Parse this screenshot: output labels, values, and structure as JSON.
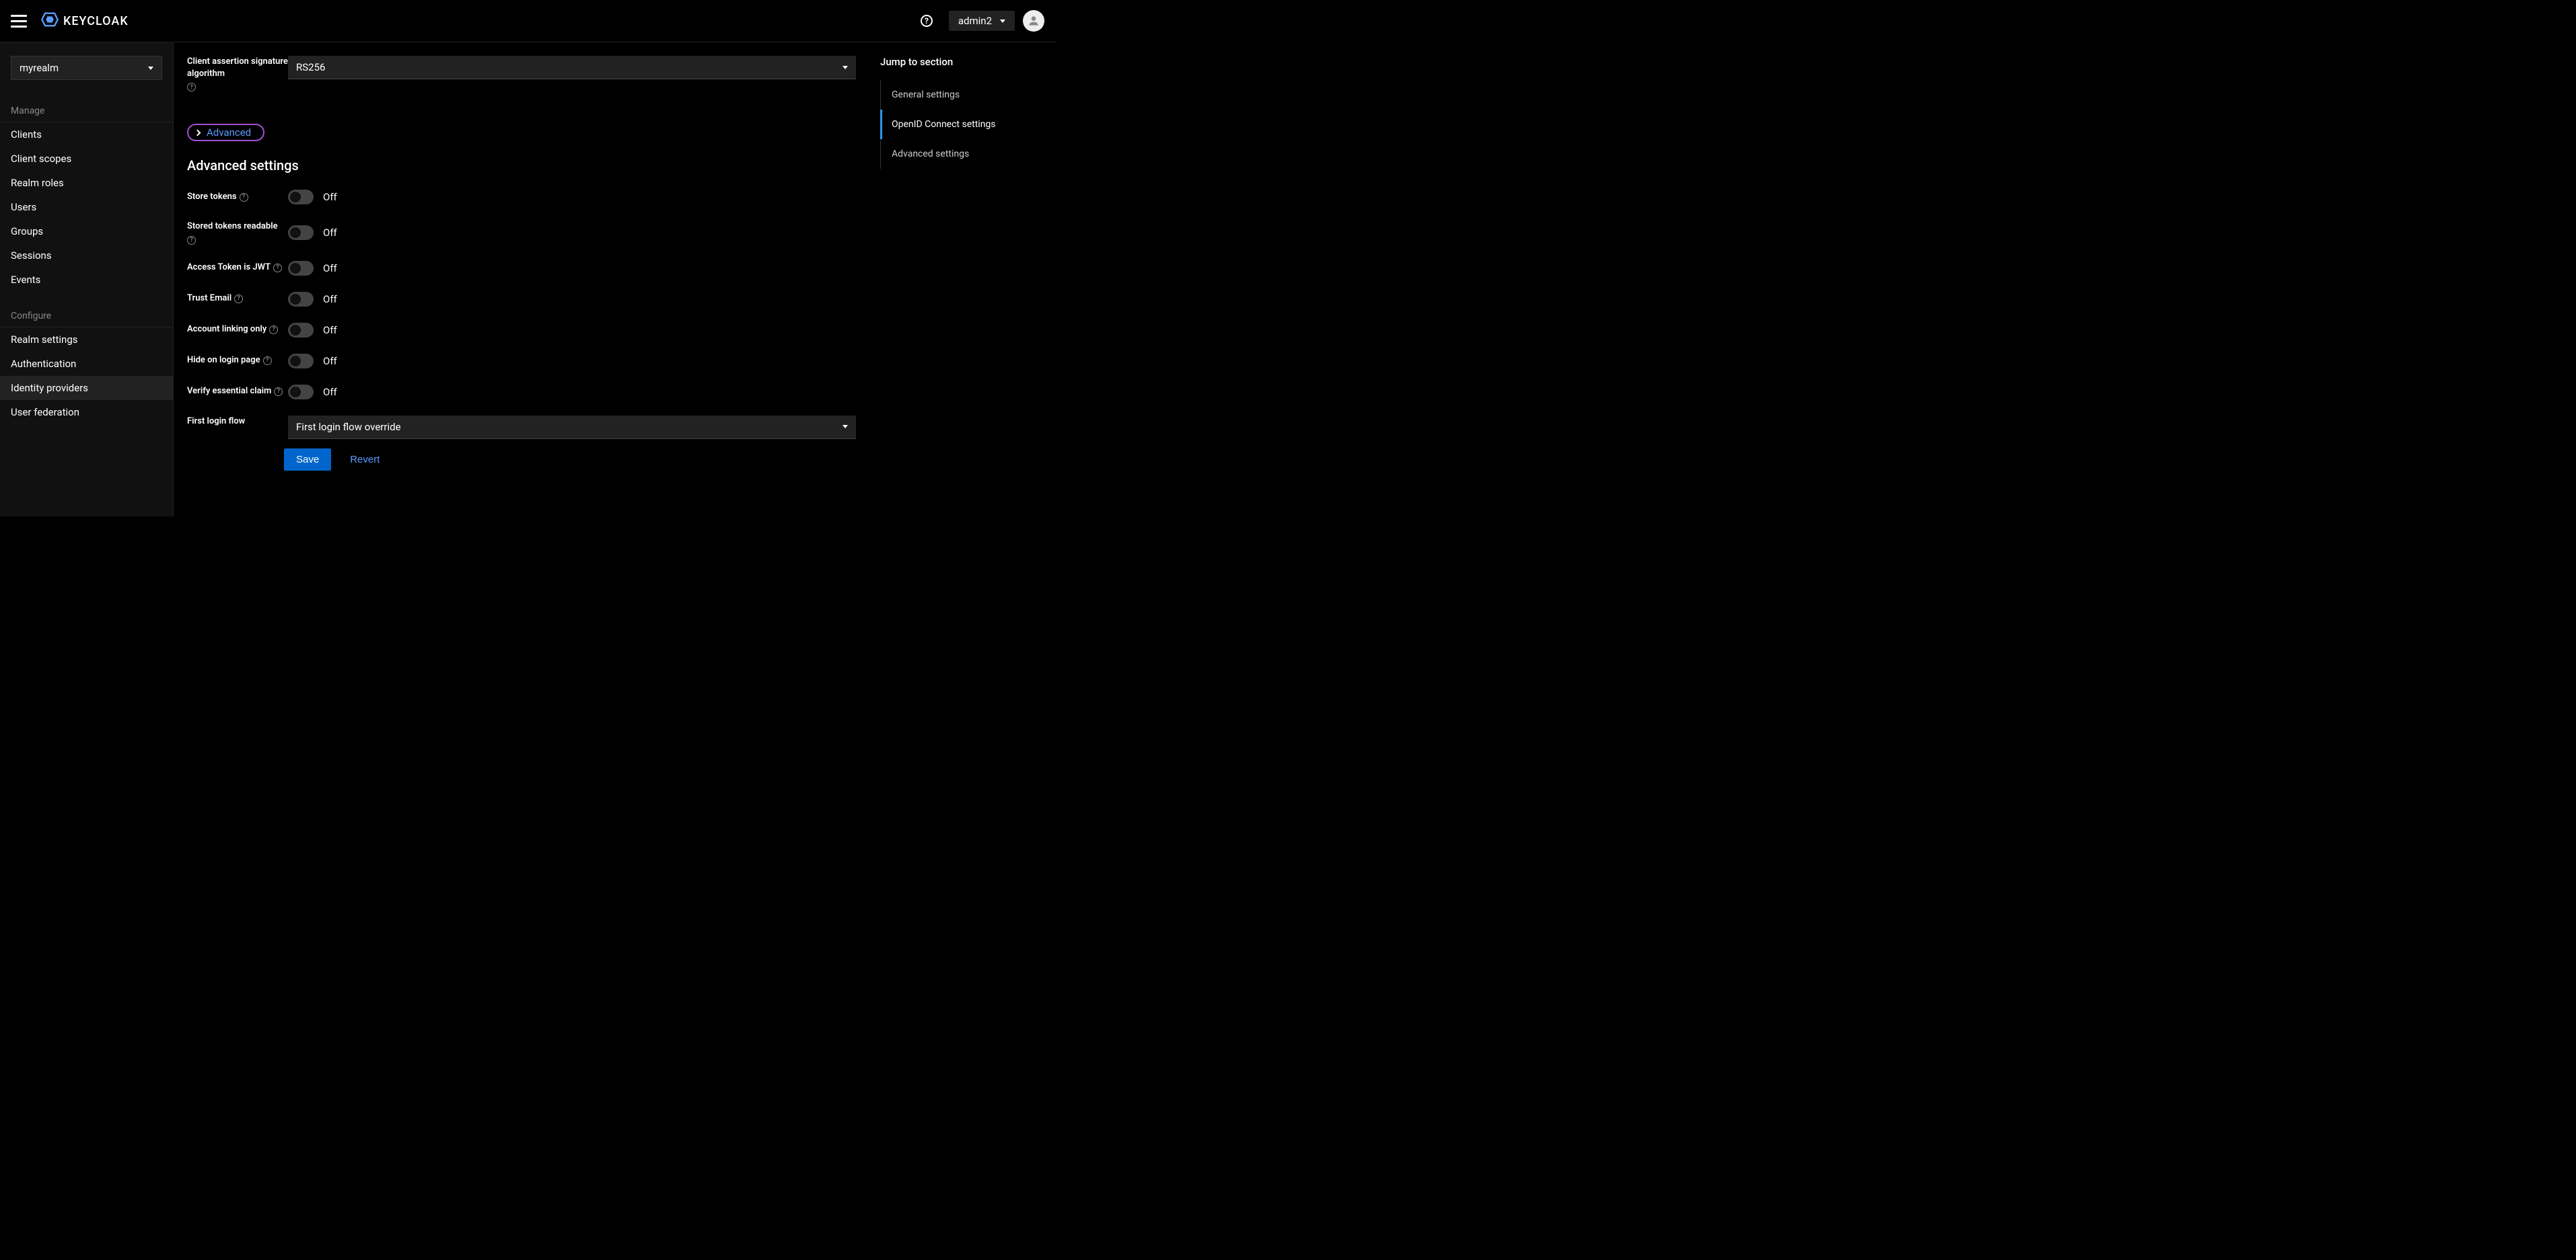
{
  "header": {
    "brand": "KEYCLOAK",
    "user": "admin2"
  },
  "sidebar": {
    "realm": "myrealm",
    "sections": [
      {
        "label": "Manage",
        "items": [
          "Clients",
          "Client scopes",
          "Realm roles",
          "Users",
          "Groups",
          "Sessions",
          "Events"
        ]
      },
      {
        "label": "Configure",
        "items": [
          "Realm settings",
          "Authentication",
          "Identity providers",
          "User federation"
        ]
      }
    ],
    "active": "Identity providers"
  },
  "form": {
    "client_assertion_sig_alg": {
      "label": "Client assertion signature algorithm",
      "value": "RS256"
    },
    "expand_link": "Advanced",
    "section_heading": "Advanced settings",
    "toggles": [
      {
        "label": "Store tokens",
        "state": "Off",
        "help": true
      },
      {
        "label": "Stored tokens readable",
        "state": "Off",
        "help": true
      },
      {
        "label": "Access Token is JWT",
        "state": "Off",
        "help": true
      },
      {
        "label": "Trust Email",
        "state": "Off",
        "help": true
      },
      {
        "label": "Account linking only",
        "state": "Off",
        "help": true
      },
      {
        "label": "Hide on login page",
        "state": "Off",
        "help": true
      },
      {
        "label": "Verify essential claim",
        "state": "Off",
        "help": true
      }
    ],
    "first_login_flow": {
      "label": "First login flow",
      "value": "First login flow override"
    },
    "save_label": "Save",
    "revert_label": "Revert"
  },
  "jump_nav": {
    "title": "Jump to section",
    "items": [
      "General settings",
      "OpenID Connect settings",
      "Advanced settings"
    ],
    "active": "OpenID Connect settings"
  }
}
